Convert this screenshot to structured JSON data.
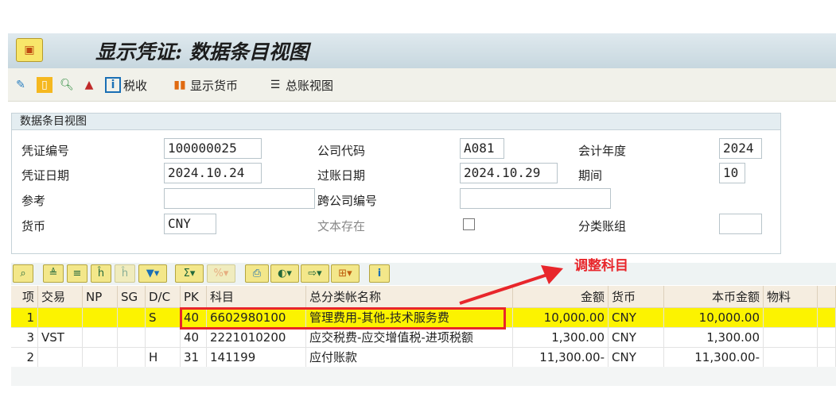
{
  "window": {
    "title": "显示凭证: 数据条目视图"
  },
  "toolbar": {
    "tax": "税收",
    "show_currency": "显示货币",
    "gl_view": "总账视图"
  },
  "panel": {
    "title": "数据条目视图",
    "doc_no_label": "凭证编号",
    "doc_no": "100000025",
    "company_label": "公司代码",
    "company": "A081",
    "fiscal_year_label": "会计年度",
    "fiscal_year": "2024",
    "doc_date_label": "凭证日期",
    "doc_date": "2024.10.24",
    "post_date_label": "过账日期",
    "post_date": "2024.10.29",
    "period_label": "期间",
    "period": "10",
    "reference_label": "参考",
    "reference": "",
    "cross_company_label": "跨公司编号",
    "cross_company": "",
    "currency_label": "货币",
    "currency": "CNY",
    "text_exists_label": "文本存在",
    "ledger_group_label": "分类账组",
    "ledger_group": ""
  },
  "grid": {
    "columns": [
      "项",
      "交易",
      "NP",
      "SG",
      "D/C",
      "PK",
      "科目",
      "总分类帐名称",
      "金额",
      "货币",
      "本币金额",
      "物料",
      ""
    ],
    "rows": [
      [
        "1",
        "",
        "",
        "",
        "S",
        "40",
        "6602980100",
        "管理费用-其他-技术服务费",
        "10,000.00",
        "CNY",
        "10,000.00",
        "",
        ""
      ],
      [
        "3",
        "VST",
        "",
        "",
        "",
        "40",
        "2221010200",
        "应交税费-应交增值税-进项税额",
        "1,300.00",
        "CNY",
        "1,300.00",
        "",
        ""
      ],
      [
        "2",
        "",
        "",
        "",
        "H",
        "31",
        "141199",
        "应付账款",
        "11,300.00-",
        "CNY",
        "11,300.00-",
        "",
        ""
      ]
    ]
  },
  "annotation": {
    "text": "调整科目",
    "color": "#e8262b"
  }
}
